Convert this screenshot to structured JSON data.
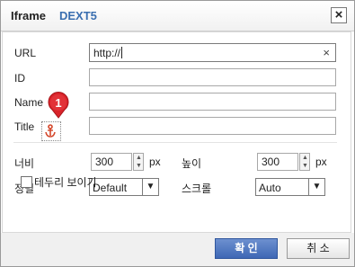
{
  "dialog": {
    "title": "Iframe",
    "product": "DEXT5",
    "close_icon": "close-icon"
  },
  "fields": {
    "url_label": "URL",
    "url_value": "http://",
    "clear_icon": "×",
    "id_label": "ID",
    "id_value": "",
    "name_label": "Name",
    "name_value": "",
    "title_label": "Title",
    "title_value": ""
  },
  "marker": {
    "number": "1",
    "color": "#d9232a",
    "icon": "anchor-icon"
  },
  "size": {
    "width_label": "너비",
    "width_value": "300",
    "width_unit": "px",
    "height_label": "높이",
    "height_value": "300",
    "height_unit": "px"
  },
  "options": {
    "align_label": "정렬",
    "align_value": "Default",
    "scroll_label": "스크롤",
    "scroll_value": "Auto",
    "border_label": "테두리 보이기",
    "border_checked": false
  },
  "buttons": {
    "ok": "확 인",
    "cancel": "취 소"
  },
  "colors": {
    "accent": "#3a6fb0",
    "primary_button": "#4a72bd"
  }
}
